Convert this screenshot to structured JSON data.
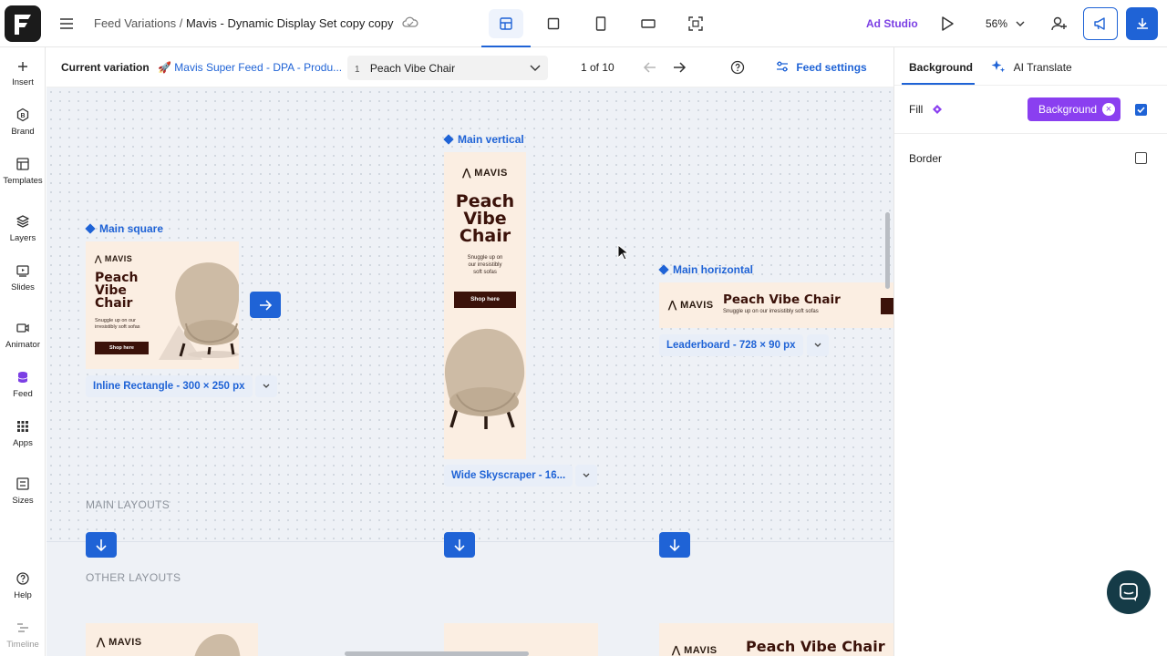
{
  "topbar": {
    "breadcrumb_parent": "Feed Variations /",
    "breadcrumb_current": "Mavis - Dynamic Display Set copy copy",
    "ad_studio": "Ad Studio",
    "zoom": "56%"
  },
  "sidebar": {
    "items": [
      {
        "label": "Insert",
        "icon": "plus-icon"
      },
      {
        "label": "Brand",
        "icon": "brand-icon"
      },
      {
        "label": "Templates",
        "icon": "templates-icon"
      },
      {
        "label": "Layers",
        "icon": "layers-icon"
      },
      {
        "label": "Slides",
        "icon": "slides-icon"
      },
      {
        "label": "Animator",
        "icon": "animator-icon"
      },
      {
        "label": "Feed",
        "icon": "feed-icon"
      },
      {
        "label": "Apps",
        "icon": "apps-icon"
      },
      {
        "label": "Sizes",
        "icon": "sizes-icon"
      },
      {
        "label": "Help",
        "icon": "help-icon"
      },
      {
        "label": "Timeline",
        "icon": "timeline-icon"
      }
    ]
  },
  "variation_bar": {
    "label": "Current variation",
    "feed_name": "🚀 Mavis Super Feed - DPA - Produ...",
    "selected_index": "1",
    "selected_name": "Peach Vibe Chair",
    "count": "1 of 10",
    "feed_settings": "Feed settings"
  },
  "canvas": {
    "frames": {
      "square": {
        "title": "Main square",
        "size": "Inline Rectangle - 300 × 250 px"
      },
      "vertical": {
        "title": "Main vertical",
        "size": "Wide Skyscraper - 16..."
      },
      "horizontal": {
        "title": "Main horizontal",
        "size": "Leaderboard - 728 × 90 px"
      }
    },
    "ad": {
      "brand": "MAVIS",
      "headline": "Peach Vibe Chair",
      "headline_lines": [
        "Peach",
        "Vibe",
        "Chair"
      ],
      "subtext": "Snuggle up on our irresistibly soft sofas",
      "sub_lines_v": [
        "Snuggle up on",
        "our irresistibly",
        "soft sofas"
      ],
      "sub_lines_sq": [
        "Snuggle up on our",
        "irresistibly soft sofas"
      ],
      "cta": "Shop here"
    },
    "sections": {
      "main": "MAIN LAYOUTS",
      "other": "OTHER LAYOUTS"
    }
  },
  "right_panel": {
    "tabs": {
      "background": "Background",
      "ai_translate": "AI Translate"
    },
    "fill_label": "Fill",
    "fill_chip": "Background",
    "fill_checked": true,
    "border_label": "Border",
    "border_checked": false
  },
  "colors": {
    "accent": "#1f63d6",
    "purple": "#8a3ff0",
    "ad_bg": "#fbeee2",
    "ad_brown": "#3b120a"
  }
}
